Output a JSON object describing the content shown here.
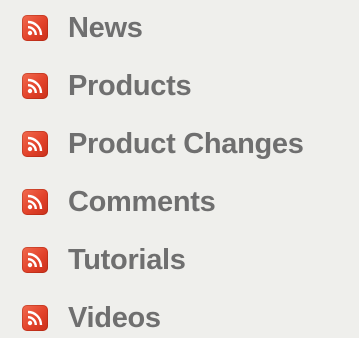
{
  "feeds": {
    "icon": "rss-feed-icon",
    "icon_color": "#e2422a",
    "label_color": "#6f6f6f",
    "items": [
      {
        "label": "News"
      },
      {
        "label": "Products"
      },
      {
        "label": "Product Changes"
      },
      {
        "label": "Comments"
      },
      {
        "label": "Tutorials"
      },
      {
        "label": "Videos"
      }
    ]
  }
}
